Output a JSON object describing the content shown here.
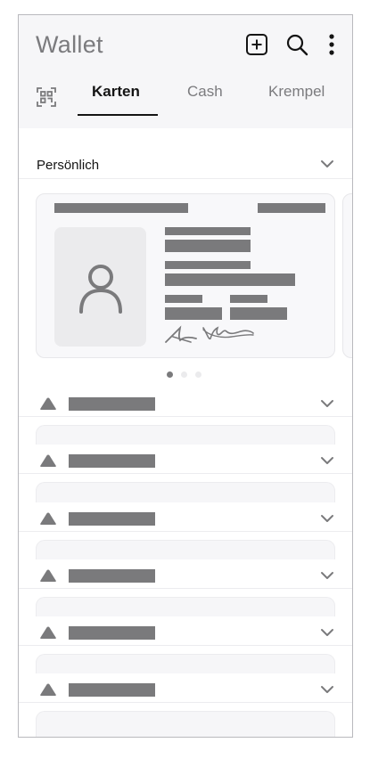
{
  "header": {
    "title": "Wallet",
    "icons": [
      "add-icon",
      "search-icon",
      "more-vertical-icon"
    ]
  },
  "tabs": [
    {
      "label": "Karten",
      "active": true
    },
    {
      "label": "Cash",
      "active": false
    },
    {
      "label": "Krempel",
      "active": false
    }
  ],
  "section": {
    "label": "Persönlich",
    "expanded": true
  },
  "carousel": {
    "page_count": 3,
    "active_page": 1
  },
  "groups": [
    {
      "expanded": false
    },
    {
      "expanded": false
    },
    {
      "expanded": false
    },
    {
      "expanded": false
    },
    {
      "expanded": false
    },
    {
      "expanded": false
    }
  ],
  "colors": {
    "placeholder": "#7a7a7c",
    "header_bg": "#f6f6f8",
    "active_tab": "#141414"
  }
}
